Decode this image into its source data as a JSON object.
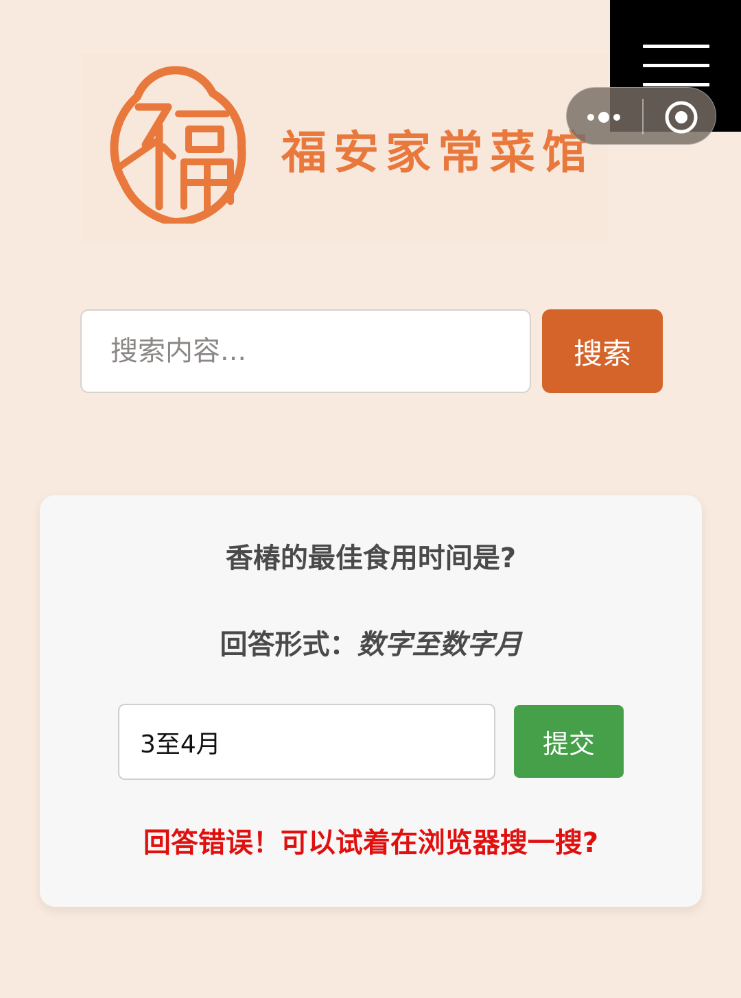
{
  "header": {
    "brand_name": "福安家常菜馆",
    "logo_icon": "fu-seal-logo",
    "brand_color": "#e8783c"
  },
  "miniprogram_bar": {
    "menu_icon": "hamburger-icon",
    "more_icon": "more-dots-icon",
    "close_icon": "close-target-icon"
  },
  "search": {
    "placeholder": "搜索内容...",
    "button_label": "搜索",
    "button_color": "#d4642a"
  },
  "quiz": {
    "question": "香椿的最佳食用时间是?",
    "format_label": "回答形式：",
    "format_value": "数字至数字月",
    "answer_value": "3至4月",
    "submit_label": "提交",
    "submit_color": "#46a049",
    "feedback": "回答错误！可以试着在浏览器搜一搜?",
    "feedback_color": "#e0100f"
  }
}
